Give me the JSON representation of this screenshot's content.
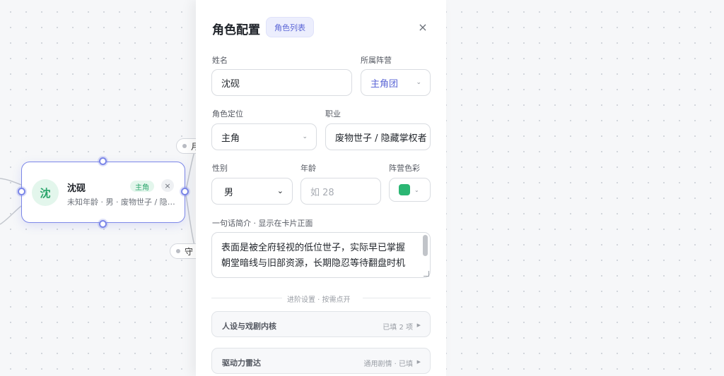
{
  "canvas": {
    "edge_labels": [
      "月",
      "守"
    ],
    "node": {
      "avatar": "沈",
      "name": "沈砚",
      "badge": "主角",
      "subtitle": "未知年龄 · 男 · 废物世子 / 隐藏掌权者",
      "close_glyph": "×"
    }
  },
  "panel": {
    "title": "角色配置",
    "list_button": "角色列表",
    "close_glyph": "×",
    "fields": {
      "name_label": "姓名",
      "name_value": "沈砚",
      "faction_label": "所属阵营",
      "faction_value": "主角团",
      "role_label": "角色定位",
      "role_value": "主角",
      "job_label": "职业",
      "job_value": "废物世子 / 隐藏掌权者",
      "gender_label": "性别",
      "gender_value": "男",
      "age_label": "年龄",
      "age_placeholder": "如 28",
      "color_label": "阵营色彩",
      "color_value": "#2bb673"
    },
    "intro_label": "一句话简介 · 显示在卡片正面",
    "intro_text": "表面是被全府轻视的低位世子，实际早已掌握朝堂暗线与旧部资源，长期隐忍等待翻盘时机",
    "advanced_divider": "进阶设置 · 按需点开",
    "sections": [
      {
        "title": "人设与戏剧内核",
        "meta": "已填 2 项"
      },
      {
        "title": "驱动力雷达",
        "meta": "通用剧情 · 已填"
      }
    ]
  },
  "colors": {
    "accent": "#5b66d6",
    "node_border": "#7b86e8",
    "green": "#2aa56b"
  }
}
